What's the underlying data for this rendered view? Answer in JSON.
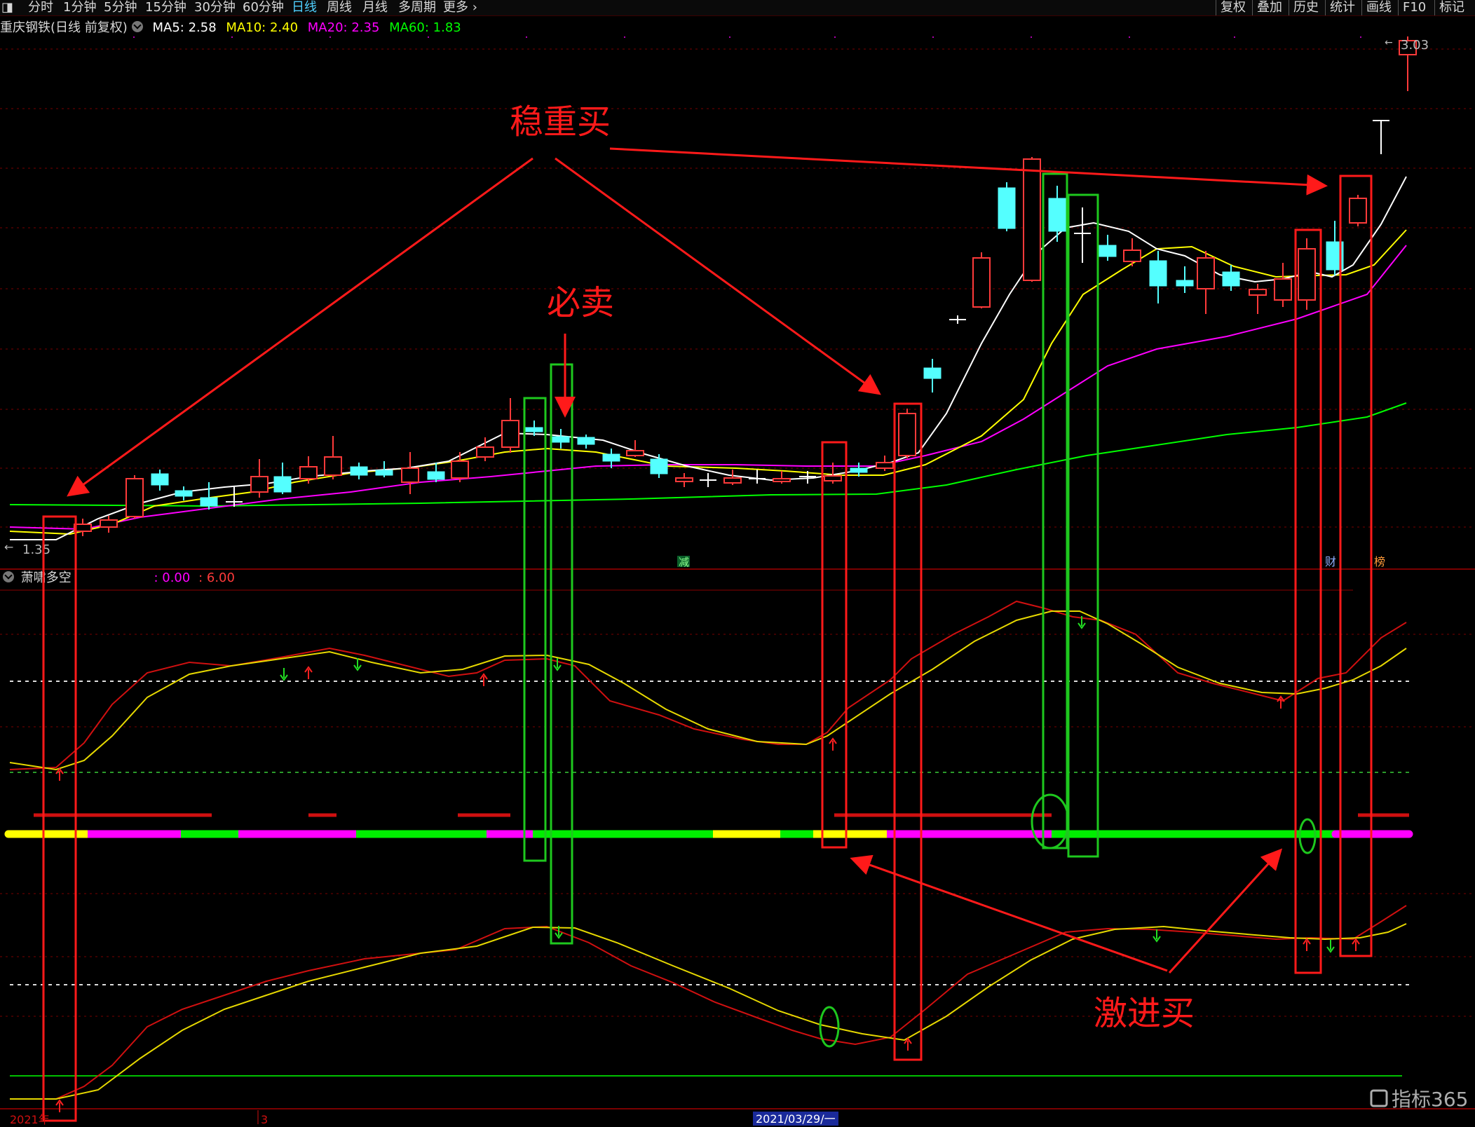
{
  "toolbar": {
    "left_items": [
      "分时",
      "1分钟",
      "5分钟",
      "15分钟",
      "30分钟",
      "60分钟",
      "日线",
      "周线",
      "月线",
      "多周期",
      "更多"
    ],
    "active_item": "日线",
    "right_items": [
      "复权",
      "叠加",
      "历史",
      "统计",
      "画线",
      "F10",
      "标记"
    ]
  },
  "info": {
    "stock_name": "重庆钢铁(日线 前复权)",
    "ma5": "MA5: 2.58",
    "ma10": "MA10: 2.40",
    "ma20": "MA20: 2.35",
    "ma60": "MA60: 1.83"
  },
  "indicator": {
    "name": "萧啸多空",
    "value1": ": 0.00",
    "value2": ": 6.00"
  },
  "price_labels": {
    "high": "3.03",
    "low": "1.35"
  },
  "markers": {
    "jian": "减",
    "cai": "财",
    "bang": "榜"
  },
  "annotations": {
    "steady_buy": "稳重买",
    "must_sell": "必卖",
    "aggressive_buy": "激进买"
  },
  "date_axis": {
    "year": "2021年",
    "month": "3",
    "cursor_date": "2021/03/29/一"
  },
  "watermark": "指标365",
  "colors": {
    "up": "#ff3a3a",
    "down": "#54ffff",
    "ma5": "#ffffff",
    "ma10": "#ffff00",
    "ma20": "#ff00ff",
    "ma60": "#00ff00",
    "annotation": "#ff1a1a",
    "green_box": "#1ec81e"
  }
}
